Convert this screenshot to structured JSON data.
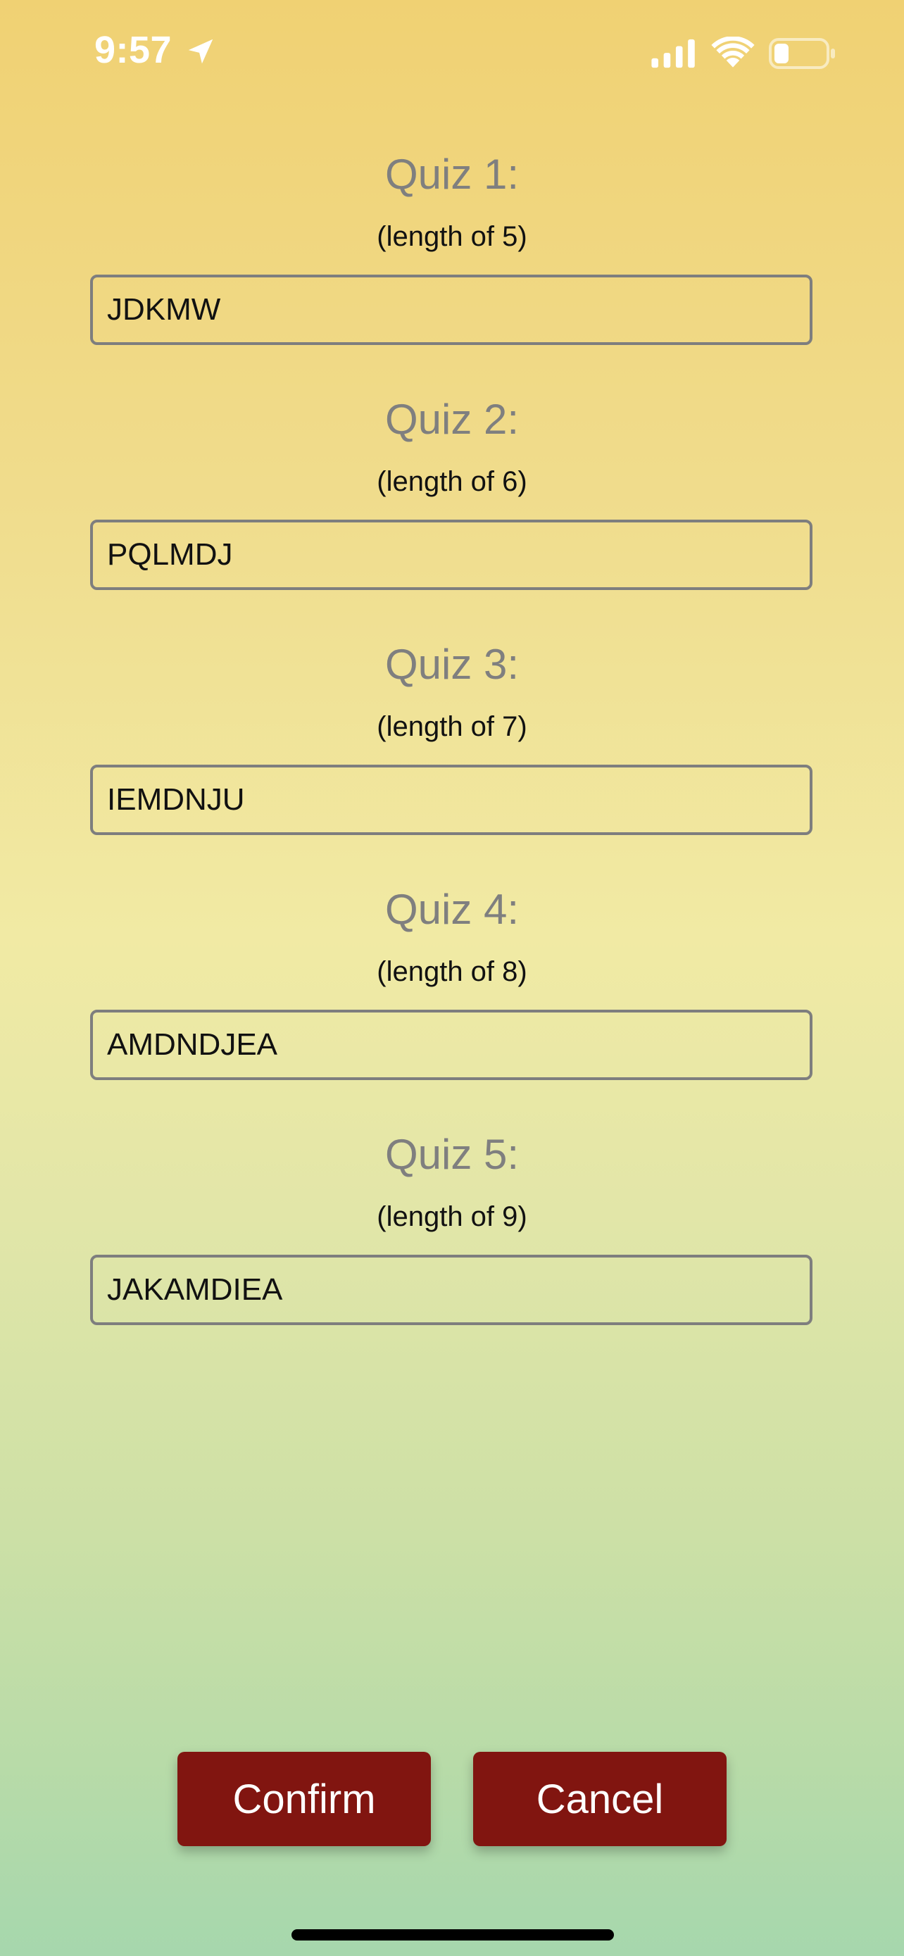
{
  "status_bar": {
    "time": "9:57",
    "icons": [
      "location-arrow-icon",
      "cellular-signal-icon",
      "wifi-icon",
      "battery-icon"
    ]
  },
  "quizzes": [
    {
      "title": "Quiz 1:",
      "length_label": "(length of 5)",
      "value": "JDKMW"
    },
    {
      "title": "Quiz 2:",
      "length_label": "(length of 6)",
      "value": "PQLMDJ"
    },
    {
      "title": "Quiz 3:",
      "length_label": "(length of 7)",
      "value": "IEMDNJU"
    },
    {
      "title": "Quiz 4:",
      "length_label": "(length of 8)",
      "value": "AMDNDJEA"
    },
    {
      "title": "Quiz 5:",
      "length_label": "(length of 9)",
      "value": "JAKAMDIEA"
    }
  ],
  "buttons": {
    "confirm_label": "Confirm",
    "cancel_label": "Cancel"
  },
  "colors": {
    "gradient_top": "#f0d173",
    "gradient_bottom": "#a6d7ad",
    "button_background": "#811510",
    "title_text": "#7f7f7f",
    "input_border": "#7e7e7e"
  }
}
